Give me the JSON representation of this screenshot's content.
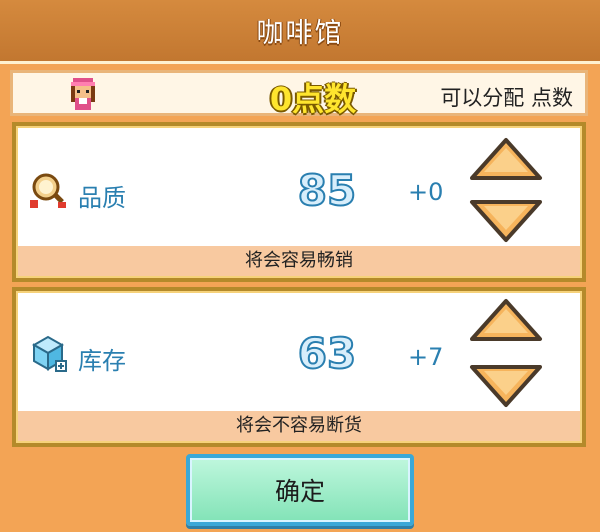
{
  "header": {
    "title": "咖啡馆"
  },
  "points": {
    "value": "0点数",
    "caption": "可以分配 点数"
  },
  "stats": [
    {
      "name": "品质",
      "value": "85",
      "delta": "+0",
      "hint": "将会容易畅销"
    },
    {
      "name": "库存",
      "value": "63",
      "delta": "+7",
      "hint": "将会不容易断货"
    }
  ],
  "icons": {
    "avatar": "staff-avatar-icon",
    "quality": "quality-magnifier-icon",
    "stock": "stock-box-icon",
    "increase": "arrow-up-icon",
    "decrease": "arrow-down-icon"
  },
  "colors": {
    "background": "#f3a455",
    "stat_text": "#2a7fb0",
    "points_text": "#ffe52e",
    "arrow_fill": "#f6b45c",
    "confirm_button": "#82e3b7"
  },
  "confirm": {
    "label": "确定"
  }
}
